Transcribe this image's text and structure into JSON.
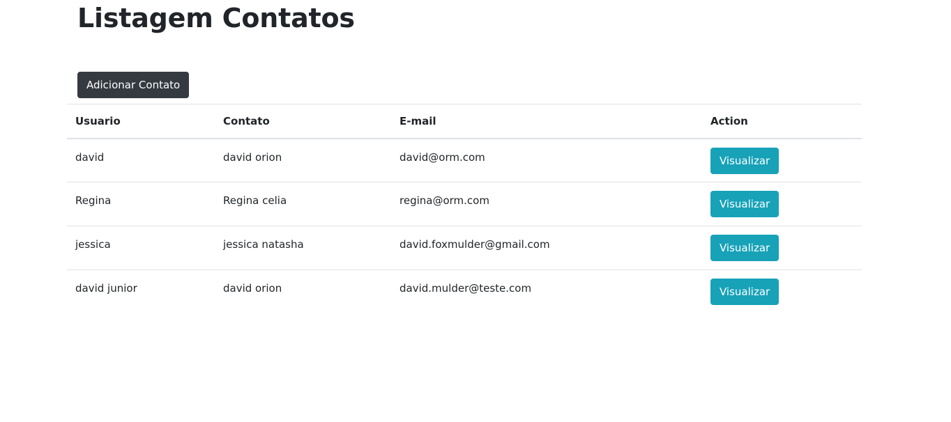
{
  "page": {
    "title": "Listagem Contatos"
  },
  "toolbar": {
    "add_label": "Adicionar Contato"
  },
  "table": {
    "headers": {
      "user": "Usuario",
      "contact": "Contato",
      "email": "E-mail",
      "action": "Action"
    },
    "rows": [
      {
        "user": "david",
        "contact": "david orion",
        "email": "david@orm.com",
        "action_label": "Visualizar"
      },
      {
        "user": "Regina",
        "contact": "Regina celia",
        "email": "regina@orm.com",
        "action_label": "Visualizar"
      },
      {
        "user": "jessica",
        "contact": "jessica natasha",
        "email": "david.foxmulder@gmail.com",
        "action_label": "Visualizar"
      },
      {
        "user": "david junior",
        "contact": "david orion",
        "email": "david.mulder@teste.com",
        "action_label": "Visualizar"
      }
    ]
  },
  "colors": {
    "primary_dark": "#343a40",
    "info": "#17a2b8",
    "border": "#dee2e6",
    "text": "#212529"
  }
}
